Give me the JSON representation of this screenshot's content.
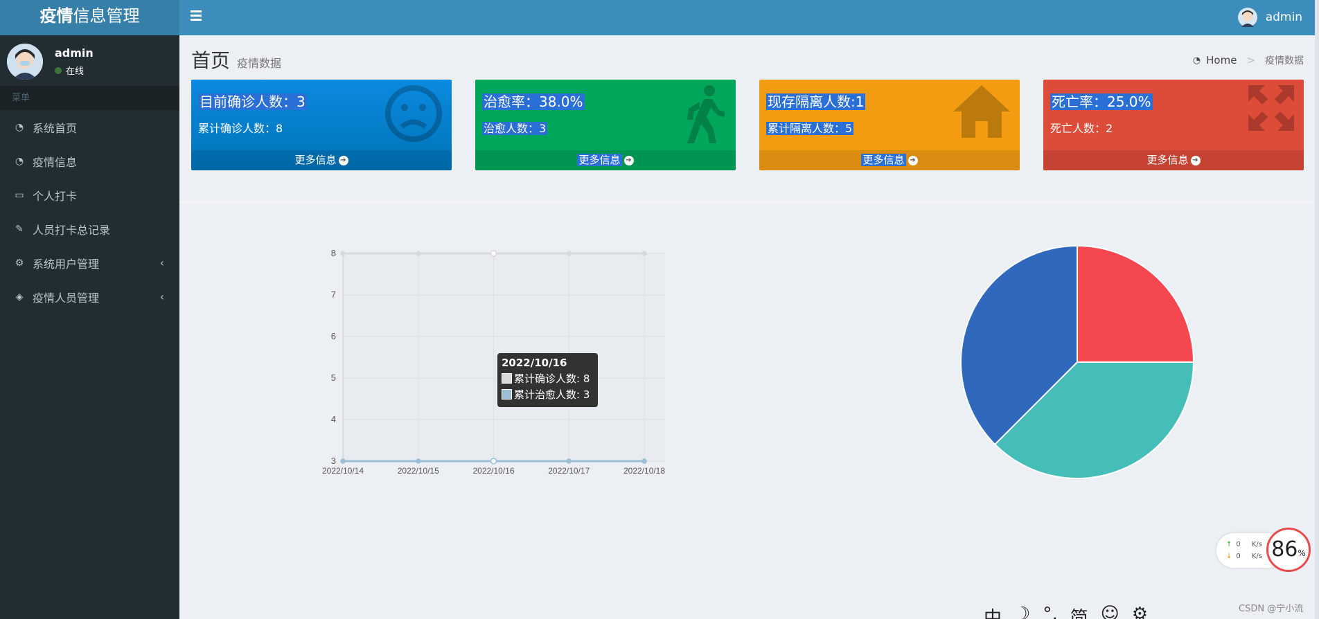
{
  "app": {
    "logo_bold": "疫情",
    "logo_rest": "信息管理",
    "user_name": "admin"
  },
  "sidebar": {
    "user_name": "admin",
    "status": "在线",
    "menu_header": "菜单",
    "items": [
      {
        "label": "系统首页",
        "icon": "dashboard-icon"
      },
      {
        "label": "疫情信息",
        "icon": "dashboard-icon"
      },
      {
        "label": "个人打卡",
        "icon": "laptop-icon"
      },
      {
        "label": "人员打卡总记录",
        "icon": "edit-icon"
      },
      {
        "label": "系统用户管理",
        "icon": "gears-icon",
        "arrow": "‹"
      },
      {
        "label": "疫情人员管理",
        "icon": "cube-icon",
        "arrow": "‹"
      }
    ]
  },
  "content_header": {
    "title": "首页",
    "subtitle": "疫情数据",
    "breadcrumb_home": "Home",
    "breadcrumb_sep": ">",
    "breadcrumb_active": "疫情数据"
  },
  "boxes": [
    {
      "title": "目前确诊人数：3",
      "detail": "累计确诊人数：8",
      "footer": "更多信息",
      "color": "#0073b7",
      "icon": "frown-icon"
    },
    {
      "title": "治愈率：38.0%",
      "detail": "治愈人数：3",
      "footer": "更多信息",
      "color": "#00a65a",
      "icon": "walking-icon"
    },
    {
      "title": "现存隔离人数:1",
      "detail": "累计隔离人数：5",
      "footer": "更多信息",
      "color": "#f39c12",
      "icon": "home-icon"
    },
    {
      "title": "死亡率：25.0%",
      "detail": "死亡人数：2",
      "footer": "更多信息",
      "color": "#dd4b39",
      "icon": "expand-icon"
    }
  ],
  "chart_data": [
    {
      "type": "line",
      "x": [
        "2022/10/14",
        "2022/10/15",
        "2022/10/16",
        "2022/10/17",
        "2022/10/18"
      ],
      "series": [
        {
          "name": "累计确诊人数",
          "values": [
            8,
            8,
            8,
            8,
            8
          ],
          "color": "#d9d9d9"
        },
        {
          "name": "累计治愈人数",
          "values": [
            3,
            3,
            3,
            3,
            3
          ],
          "color": "#9bbfd6"
        }
      ],
      "ylim": [
        3,
        8
      ],
      "yticks": [
        3,
        4,
        5,
        6,
        7,
        8
      ],
      "grid": true,
      "tooltip": {
        "title": "2022/10/16",
        "rows": [
          "累计确诊人数: 8",
          "累计治愈人数: 3"
        ]
      }
    },
    {
      "type": "pie",
      "values": [
        2,
        3,
        3
      ],
      "colors": [
        "#f5474f",
        "#45beba",
        "#2f68bd"
      ]
    }
  ],
  "speed_widget": {
    "up": "0",
    "down": "0",
    "unit": "K/s",
    "percent": "86",
    "percent_sign": "%"
  },
  "watermark": "CSDN @宁小流",
  "ime_bar": [
    "中",
    "☽",
    "°,",
    "简",
    "☺",
    "⚙"
  ]
}
